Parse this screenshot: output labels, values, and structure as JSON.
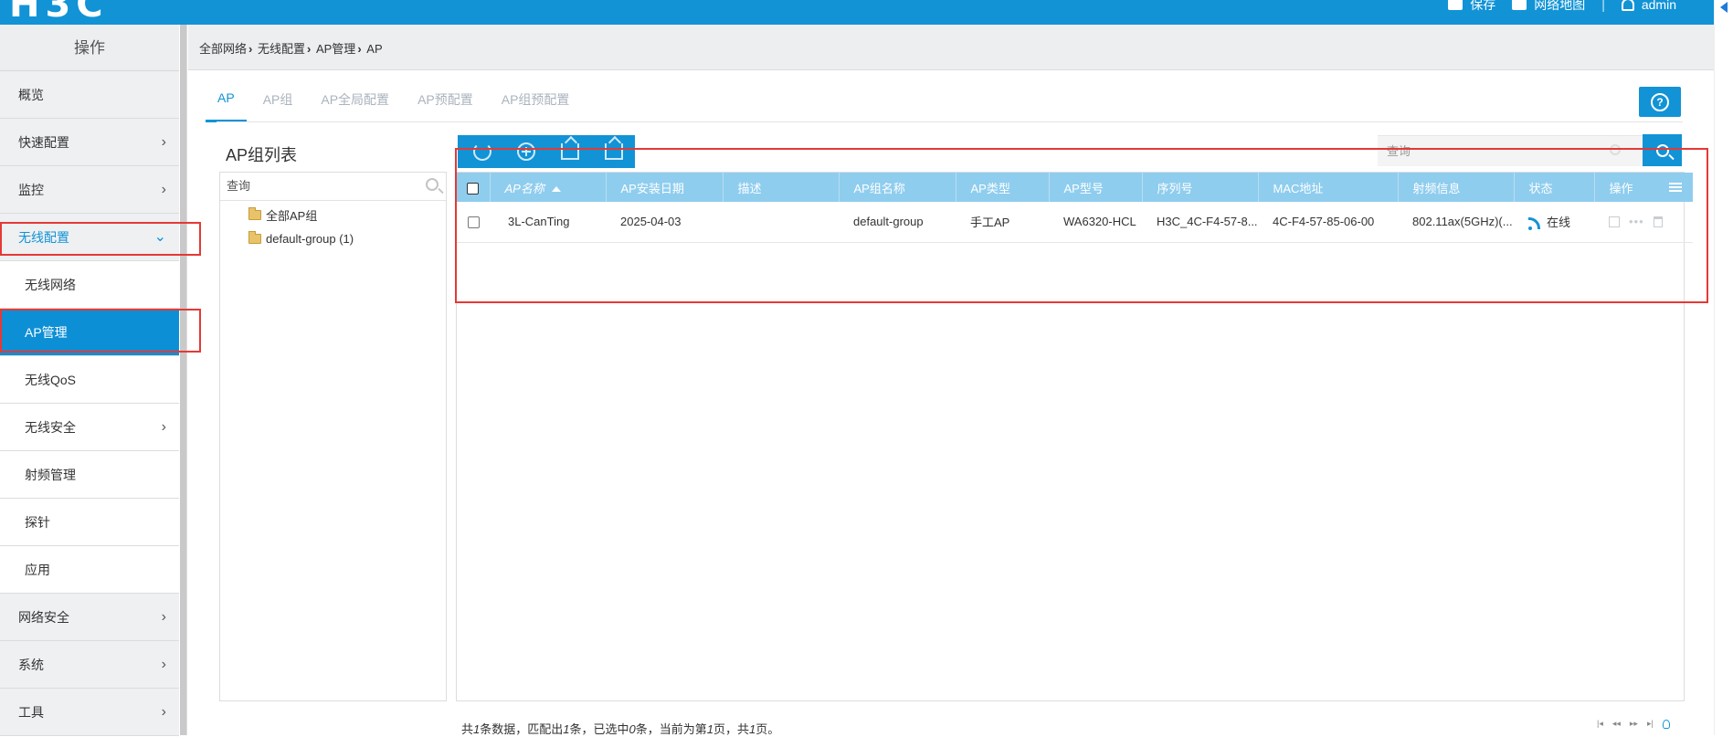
{
  "header": {
    "logo": "H3C",
    "actions": [
      {
        "label": "保存",
        "icon": "save-icon"
      },
      {
        "label": "网络地图",
        "icon": "map-icon"
      },
      {
        "label": "admin",
        "icon": "user-icon"
      }
    ]
  },
  "sidebar": {
    "title": "操作",
    "items": [
      {
        "label": "概览",
        "chevron": false
      },
      {
        "label": "快速配置",
        "chevron": true
      },
      {
        "label": "监控",
        "chevron": true
      },
      {
        "label": "无线配置",
        "chevron": true,
        "state": "open"
      },
      {
        "label": "无线网络",
        "sub": true
      },
      {
        "label": "AP管理",
        "sub": true,
        "state": "active"
      },
      {
        "label": "无线QoS",
        "sub": true
      },
      {
        "label": "无线安全",
        "sub": true,
        "chevron": true
      },
      {
        "label": "射频管理",
        "sub": true
      },
      {
        "label": "探针",
        "sub": true
      },
      {
        "label": "应用",
        "sub": true
      },
      {
        "label": "网络安全",
        "chevron": true
      },
      {
        "label": "系统",
        "chevron": true
      },
      {
        "label": "工具",
        "chevron": true
      }
    ]
  },
  "breadcrumb": [
    "全部网络",
    "无线配置",
    "AP管理",
    "AP"
  ],
  "tabs": [
    "AP",
    "AP组",
    "AP全局配置",
    "AP预配置",
    "AP组预配置"
  ],
  "group_panel": {
    "title": "AP组列表",
    "search_placeholder": "查询",
    "tree": [
      {
        "label": "全部AP组",
        "level": "root"
      },
      {
        "label": "default-group (1)",
        "level": "child"
      }
    ]
  },
  "table": {
    "search_placeholder": "查询",
    "columns": [
      "AP名称",
      "AP安装日期",
      "描述",
      "AP组名称",
      "AP类型",
      "AP型号",
      "序列号",
      "MAC地址",
      "射频信息",
      "状态",
      "操作"
    ],
    "rows": [
      {
        "name": "3L-CanTing",
        "install_date": "2025-04-03",
        "description": "",
        "group": "default-group",
        "type": "手工AP",
        "model": "WA6320-HCL",
        "serial": "H3C_4C-F4-57-8...",
        "mac": "4C-F4-57-85-06-00",
        "radio": "802.11ax(5GHz)(...",
        "status": "在线"
      }
    ]
  },
  "footer": {
    "prefix": "共",
    "total": "1",
    "mid1": "条数据，匹配出",
    "matched": "1",
    "mid2": "条，已选中",
    "selected": "0",
    "mid3": "条，当前为第",
    "page": "1",
    "mid4": "页，共",
    "pages": "1",
    "suffix": "页。"
  },
  "colors": {
    "primary": "#1193d6",
    "table_header": "#8fcdee",
    "highlight_box": "#e53935"
  }
}
